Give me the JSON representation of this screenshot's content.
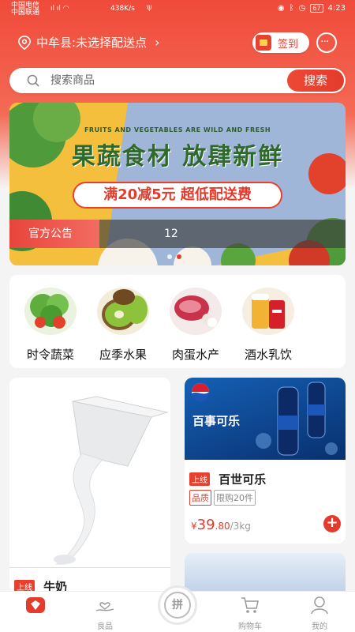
{
  "status_bar": {
    "carrier1": "中国电信",
    "carrier2": "中国联通",
    "speed": "438K/s",
    "battery": "67",
    "time": "4:23"
  },
  "location": {
    "text": "中牟县:未选择配送点"
  },
  "signin": {
    "label": "签到"
  },
  "search": {
    "placeholder": "搜索商品",
    "button": "搜索"
  },
  "banner": {
    "subtitle_en": "FRUITS AND VEGETABLES ARE WILD AND FRESH",
    "title": "果蔬食材 放肆新鲜",
    "promo": "满20减5元 超低配送费",
    "notice_tag": "官方公告",
    "notice_text": "12",
    "slide_count": 2,
    "active_slide": 2
  },
  "categories": [
    {
      "label": "时令蔬菜",
      "icon": "vegetables-icon"
    },
    {
      "label": "应季水果",
      "icon": "kiwi-icon"
    },
    {
      "label": "肉蛋水产",
      "icon": "meat-icon"
    },
    {
      "label": "酒水乳饮",
      "icon": "drinks-icon"
    }
  ],
  "products": {
    "milk": {
      "tag": "上线",
      "name": "牛奶"
    },
    "pepsi": {
      "image_text": "百事可乐",
      "tag": "上线",
      "name": "百世可乐",
      "chips": [
        "品质",
        "限购20件"
      ],
      "currency": "¥",
      "price_int": "39",
      "price_dec": ".80",
      "unit": "/3kg"
    }
  },
  "bottom_nav": [
    {
      "label": "",
      "icon": "home-icon",
      "active": true
    },
    {
      "label": "良品",
      "icon": "hand-heart-icon"
    },
    {
      "label": "拼",
      "icon": "group-buy-icon"
    },
    {
      "label": "购物车",
      "icon": "cart-icon"
    },
    {
      "label": "我的",
      "icon": "user-icon"
    }
  ],
  "colors": {
    "brand": "#e33b2c",
    "brand_light": "#f46a55"
  }
}
